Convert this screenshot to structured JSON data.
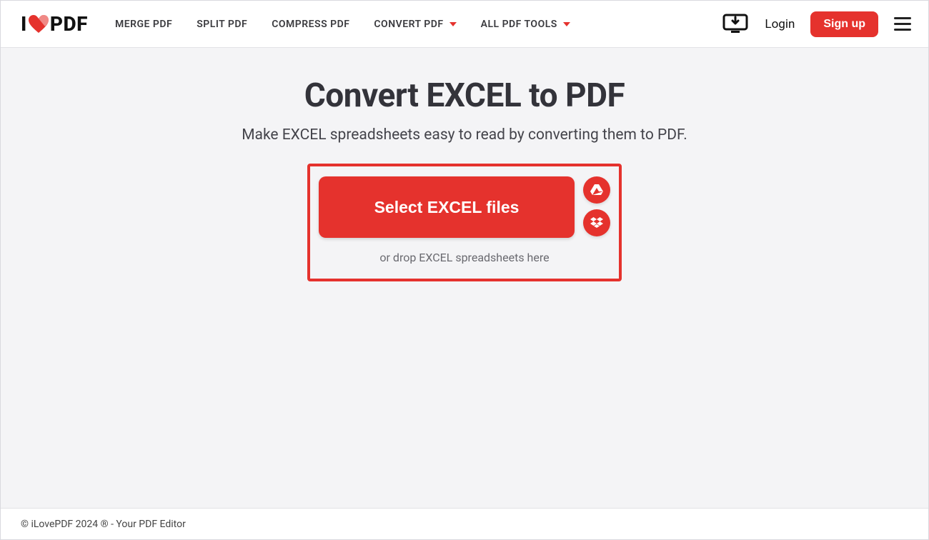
{
  "logo": {
    "prefix": "I",
    "suffix": "PDF"
  },
  "nav": {
    "merge": "MERGE PDF",
    "split": "SPLIT PDF",
    "compress": "COMPRESS PDF",
    "convert": "CONVERT PDF",
    "all": "ALL PDF TOOLS"
  },
  "auth": {
    "login": "Login",
    "signup": "Sign up"
  },
  "page": {
    "title": "Convert EXCEL to PDF",
    "subtitle": "Make EXCEL spreadsheets easy to read by converting them to PDF.",
    "select_button": "Select EXCEL files",
    "drop_text": "or drop EXCEL spreadsheets here"
  },
  "footer": {
    "text": "© iLovePDF 2024 ® - Your PDF Editor"
  }
}
